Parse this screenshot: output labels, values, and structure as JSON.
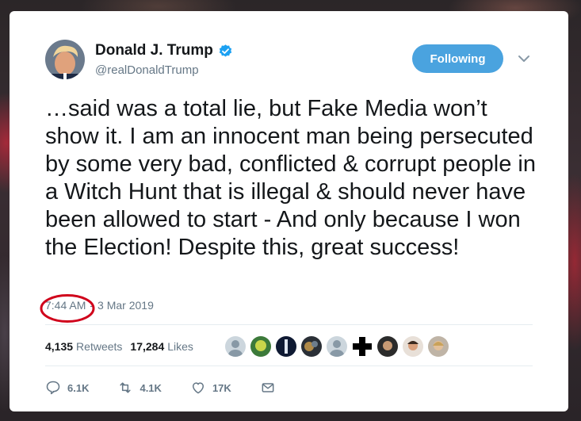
{
  "tweet": {
    "display_name": "Donald J. Trump",
    "handle": "@realDonaldTrump",
    "follow_label": "Following",
    "text": "…said was a total lie, but Fake Media won’t show it. I am an innocent man being persecuted by some very bad, conflicted & corrupt people in a Witch Hunt that is illegal & should never have been allowed to start - And only because I won the Election! Despite this, great success!",
    "time": "7:44 AM",
    "separator": "-",
    "date": "3 Mar 2019",
    "retweets_count": "4,135",
    "retweets_label": "Retweets",
    "likes_count": "17,284",
    "likes_label": "Likes",
    "actions": {
      "replies": "6.1K",
      "retweets": "4.1K",
      "likes": "17K"
    }
  },
  "colors": {
    "follow_button": "#4aa3df",
    "verified_badge": "#1da1f2",
    "highlight_ring": "#d0021b"
  },
  "icons": [
    "verified-badge-icon",
    "chevron-down-icon",
    "reply-icon",
    "retweet-icon",
    "like-icon",
    "direct-message-icon"
  ]
}
